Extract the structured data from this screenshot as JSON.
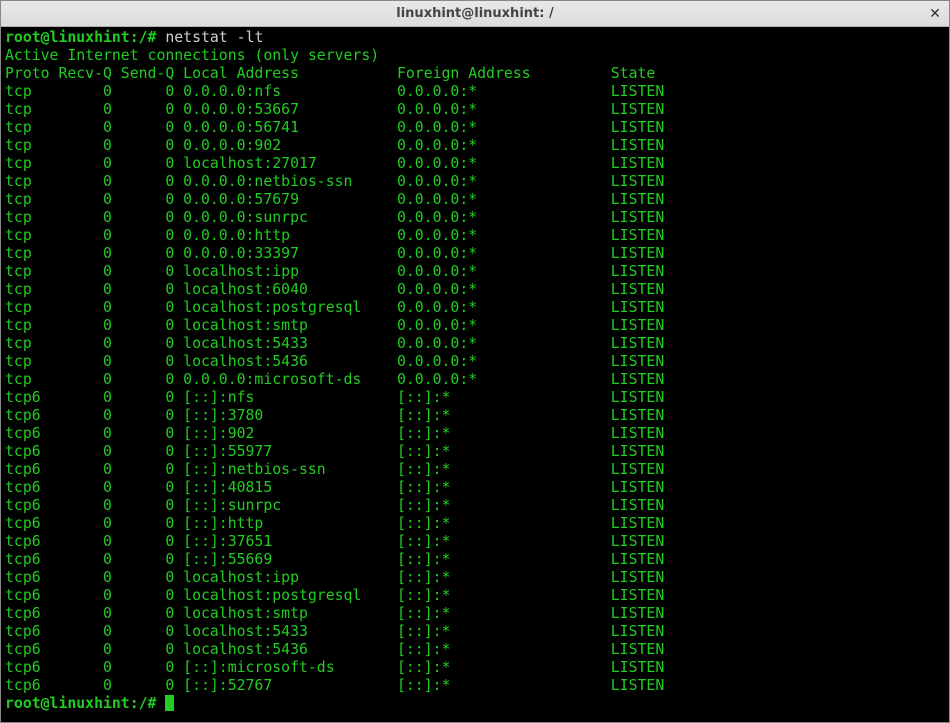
{
  "window": {
    "title": "linuxhint@linuxhint: /"
  },
  "prompt1": "root@linuxhint:/# ",
  "command": "netstat -lt",
  "header_line": "Active Internet connections (only servers)",
  "columns_line": "Proto Recv-Q Send-Q Local Address           Foreign Address         State",
  "rows": [
    {
      "proto": "tcp",
      "recvq": "0",
      "sendq": "0",
      "local": "0.0.0.0:nfs",
      "foreign": "0.0.0.0:*",
      "state": "LISTEN"
    },
    {
      "proto": "tcp",
      "recvq": "0",
      "sendq": "0",
      "local": "0.0.0.0:53667",
      "foreign": "0.0.0.0:*",
      "state": "LISTEN"
    },
    {
      "proto": "tcp",
      "recvq": "0",
      "sendq": "0",
      "local": "0.0.0.0:56741",
      "foreign": "0.0.0.0:*",
      "state": "LISTEN"
    },
    {
      "proto": "tcp",
      "recvq": "0",
      "sendq": "0",
      "local": "0.0.0.0:902",
      "foreign": "0.0.0.0:*",
      "state": "LISTEN"
    },
    {
      "proto": "tcp",
      "recvq": "0",
      "sendq": "0",
      "local": "localhost:27017",
      "foreign": "0.0.0.0:*",
      "state": "LISTEN"
    },
    {
      "proto": "tcp",
      "recvq": "0",
      "sendq": "0",
      "local": "0.0.0.0:netbios-ssn",
      "foreign": "0.0.0.0:*",
      "state": "LISTEN"
    },
    {
      "proto": "tcp",
      "recvq": "0",
      "sendq": "0",
      "local": "0.0.0.0:57679",
      "foreign": "0.0.0.0:*",
      "state": "LISTEN"
    },
    {
      "proto": "tcp",
      "recvq": "0",
      "sendq": "0",
      "local": "0.0.0.0:sunrpc",
      "foreign": "0.0.0.0:*",
      "state": "LISTEN"
    },
    {
      "proto": "tcp",
      "recvq": "0",
      "sendq": "0",
      "local": "0.0.0.0:http",
      "foreign": "0.0.0.0:*",
      "state": "LISTEN"
    },
    {
      "proto": "tcp",
      "recvq": "0",
      "sendq": "0",
      "local": "0.0.0.0:33397",
      "foreign": "0.0.0.0:*",
      "state": "LISTEN"
    },
    {
      "proto": "tcp",
      "recvq": "0",
      "sendq": "0",
      "local": "localhost:ipp",
      "foreign": "0.0.0.0:*",
      "state": "LISTEN"
    },
    {
      "proto": "tcp",
      "recvq": "0",
      "sendq": "0",
      "local": "localhost:6040",
      "foreign": "0.0.0.0:*",
      "state": "LISTEN"
    },
    {
      "proto": "tcp",
      "recvq": "0",
      "sendq": "0",
      "local": "localhost:postgresql",
      "foreign": "0.0.0.0:*",
      "state": "LISTEN"
    },
    {
      "proto": "tcp",
      "recvq": "0",
      "sendq": "0",
      "local": "localhost:smtp",
      "foreign": "0.0.0.0:*",
      "state": "LISTEN"
    },
    {
      "proto": "tcp",
      "recvq": "0",
      "sendq": "0",
      "local": "localhost:5433",
      "foreign": "0.0.0.0:*",
      "state": "LISTEN"
    },
    {
      "proto": "tcp",
      "recvq": "0",
      "sendq": "0",
      "local": "localhost:5436",
      "foreign": "0.0.0.0:*",
      "state": "LISTEN"
    },
    {
      "proto": "tcp",
      "recvq": "0",
      "sendq": "0",
      "local": "0.0.0.0:microsoft-ds",
      "foreign": "0.0.0.0:*",
      "state": "LISTEN"
    },
    {
      "proto": "tcp6",
      "recvq": "0",
      "sendq": "0",
      "local": "[::]:nfs",
      "foreign": "[::]:*",
      "state": "LISTEN"
    },
    {
      "proto": "tcp6",
      "recvq": "0",
      "sendq": "0",
      "local": "[::]:3780",
      "foreign": "[::]:*",
      "state": "LISTEN"
    },
    {
      "proto": "tcp6",
      "recvq": "0",
      "sendq": "0",
      "local": "[::]:902",
      "foreign": "[::]:*",
      "state": "LISTEN"
    },
    {
      "proto": "tcp6",
      "recvq": "0",
      "sendq": "0",
      "local": "[::]:55977",
      "foreign": "[::]:*",
      "state": "LISTEN"
    },
    {
      "proto": "tcp6",
      "recvq": "0",
      "sendq": "0",
      "local": "[::]:netbios-ssn",
      "foreign": "[::]:*",
      "state": "LISTEN"
    },
    {
      "proto": "tcp6",
      "recvq": "0",
      "sendq": "0",
      "local": "[::]:40815",
      "foreign": "[::]:*",
      "state": "LISTEN"
    },
    {
      "proto": "tcp6",
      "recvq": "0",
      "sendq": "0",
      "local": "[::]:sunrpc",
      "foreign": "[::]:*",
      "state": "LISTEN"
    },
    {
      "proto": "tcp6",
      "recvq": "0",
      "sendq": "0",
      "local": "[::]:http",
      "foreign": "[::]:*",
      "state": "LISTEN"
    },
    {
      "proto": "tcp6",
      "recvq": "0",
      "sendq": "0",
      "local": "[::]:37651",
      "foreign": "[::]:*",
      "state": "LISTEN"
    },
    {
      "proto": "tcp6",
      "recvq": "0",
      "sendq": "0",
      "local": "[::]:55669",
      "foreign": "[::]:*",
      "state": "LISTEN"
    },
    {
      "proto": "tcp6",
      "recvq": "0",
      "sendq": "0",
      "local": "localhost:ipp",
      "foreign": "[::]:*",
      "state": "LISTEN"
    },
    {
      "proto": "tcp6",
      "recvq": "0",
      "sendq": "0",
      "local": "localhost:postgresql",
      "foreign": "[::]:*",
      "state": "LISTEN"
    },
    {
      "proto": "tcp6",
      "recvq": "0",
      "sendq": "0",
      "local": "localhost:smtp",
      "foreign": "[::]:*",
      "state": "LISTEN"
    },
    {
      "proto": "tcp6",
      "recvq": "0",
      "sendq": "0",
      "local": "localhost:5433",
      "foreign": "[::]:*",
      "state": "LISTEN"
    },
    {
      "proto": "tcp6",
      "recvq": "0",
      "sendq": "0",
      "local": "localhost:5436",
      "foreign": "[::]:*",
      "state": "LISTEN"
    },
    {
      "proto": "tcp6",
      "recvq": "0",
      "sendq": "0",
      "local": "[::]:microsoft-ds",
      "foreign": "[::]:*",
      "state": "LISTEN"
    },
    {
      "proto": "tcp6",
      "recvq": "0",
      "sendq": "0",
      "local": "[::]:52767",
      "foreign": "[::]:*",
      "state": "LISTEN"
    }
  ],
  "prompt2": "root@linuxhint:/# "
}
